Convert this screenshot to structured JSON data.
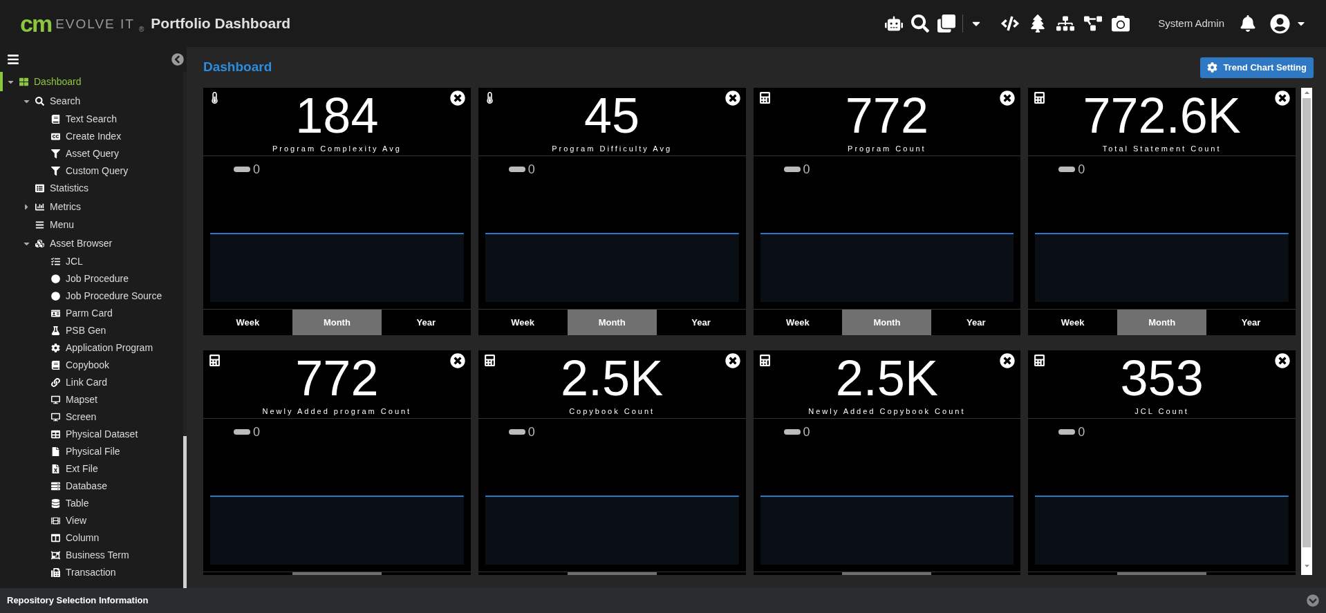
{
  "header": {
    "brand_mark": "cm",
    "brand_name": "EVOLVE IT",
    "registered": "®",
    "title": "Portfolio Dashboard",
    "user": "System Admin"
  },
  "sidebar": {
    "tree": [
      {
        "label": "Dashboard",
        "selected": true,
        "expanded": true,
        "children": [
          {
            "label": "Search",
            "selected": false,
            "expanded": true,
            "children": [
              {
                "label": "Text Search",
                "selected": false
              },
              {
                "label": "Create Index",
                "selected": false
              },
              {
                "label": "Asset Query",
                "selected": false
              },
              {
                "label": "Custom Query",
                "selected": false
              }
            ]
          },
          {
            "label": "Statistics",
            "selected": false
          },
          {
            "label": "Metrics",
            "selected": false,
            "expanded": false
          },
          {
            "label": "Menu",
            "selected": false
          },
          {
            "label": "Asset Browser",
            "selected": false,
            "expanded": true,
            "children": [
              {
                "label": "JCL",
                "selected": false
              },
              {
                "label": "Job Procedure",
                "selected": false
              },
              {
                "label": "Job Procedure Source",
                "selected": false
              },
              {
                "label": "Parm Card",
                "selected": false
              },
              {
                "label": "PSB Gen",
                "selected": false
              },
              {
                "label": "Application Program",
                "selected": false
              },
              {
                "label": "Copybook",
                "selected": false
              },
              {
                "label": "Link Card",
                "selected": false
              },
              {
                "label": "Mapset",
                "selected": false
              },
              {
                "label": "Screen",
                "selected": false
              },
              {
                "label": "Physical Dataset",
                "selected": false
              },
              {
                "label": "Physical File",
                "selected": false
              },
              {
                "label": "Ext File",
                "selected": false
              },
              {
                "label": "Database",
                "selected": false
              },
              {
                "label": "Table",
                "selected": false
              },
              {
                "label": "View",
                "selected": false
              },
              {
                "label": "Column",
                "selected": false
              },
              {
                "label": "Business Term",
                "selected": false
              },
              {
                "label": "Transaction",
                "selected": false
              }
            ]
          }
        ]
      }
    ]
  },
  "page": {
    "title": "Dashboard",
    "settings_button": "Trend Chart Setting"
  },
  "cards": [
    {
      "kind": "average",
      "value": "184",
      "label": "Program Complexity Avg",
      "legend_value": "0",
      "periods": [
        {
          "label": "Week",
          "selected": false
        },
        {
          "label": "Month",
          "selected": true
        },
        {
          "label": "Year",
          "selected": false
        }
      ]
    },
    {
      "kind": "average",
      "value": "45",
      "label": "Program Difficulty Avg",
      "legend_value": "0",
      "periods": [
        {
          "label": "Week",
          "selected": false
        },
        {
          "label": "Month",
          "selected": true
        },
        {
          "label": "Year",
          "selected": false
        }
      ]
    },
    {
      "kind": "count",
      "value": "772",
      "label": "Program Count",
      "legend_value": "0",
      "periods": [
        {
          "label": "Week",
          "selected": false
        },
        {
          "label": "Month",
          "selected": true
        },
        {
          "label": "Year",
          "selected": false
        }
      ]
    },
    {
      "kind": "count",
      "value": "772.6K",
      "label": "Total Statement Count",
      "legend_value": "0",
      "periods": [
        {
          "label": "Week",
          "selected": false
        },
        {
          "label": "Month",
          "selected": true
        },
        {
          "label": "Year",
          "selected": false
        }
      ]
    },
    {
      "kind": "count",
      "value": "772",
      "label": "Newly Added program Count",
      "legend_value": "0",
      "periods": [
        {
          "selected": false
        },
        {
          "selected": true
        },
        {
          "selected": false
        }
      ]
    },
    {
      "kind": "count",
      "value": "2.5K",
      "label": "Copybook Count",
      "legend_value": "0",
      "periods": [
        {
          "selected": false
        },
        {
          "selected": true
        },
        {
          "selected": false
        }
      ]
    },
    {
      "kind": "count",
      "value": "2.5K",
      "label": "Newly Added Copybook Count",
      "legend_value": "0",
      "periods": [
        {
          "selected": false
        },
        {
          "selected": true
        },
        {
          "selected": false
        }
      ]
    },
    {
      "kind": "count",
      "value": "353",
      "label": "JCL Count",
      "legend_value": "0",
      "periods": [
        {
          "selected": false
        },
        {
          "selected": true
        },
        {
          "selected": false
        }
      ]
    }
  ],
  "footer": {
    "title": "Repository Selection Information"
  }
}
